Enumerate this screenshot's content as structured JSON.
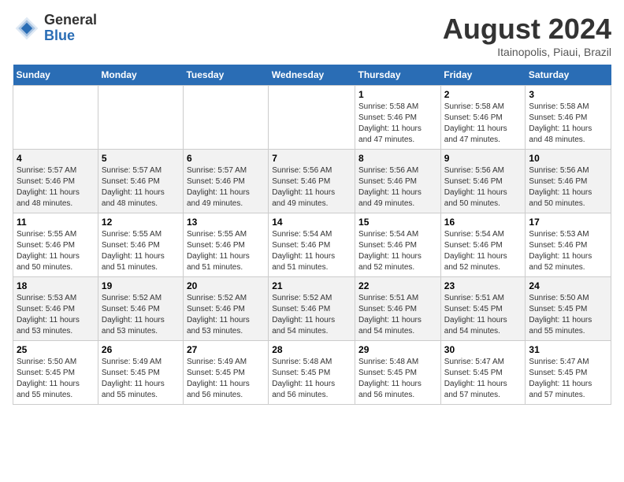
{
  "header": {
    "logo_general": "General",
    "logo_blue": "Blue",
    "month": "August 2024",
    "location": "Itainopolis, Piaui, Brazil"
  },
  "days_of_week": [
    "Sunday",
    "Monday",
    "Tuesday",
    "Wednesday",
    "Thursday",
    "Friday",
    "Saturday"
  ],
  "weeks": [
    [
      {
        "day": "",
        "info": ""
      },
      {
        "day": "",
        "info": ""
      },
      {
        "day": "",
        "info": ""
      },
      {
        "day": "",
        "info": ""
      },
      {
        "day": "1",
        "info": "Sunrise: 5:58 AM\nSunset: 5:46 PM\nDaylight: 11 hours\nand 47 minutes."
      },
      {
        "day": "2",
        "info": "Sunrise: 5:58 AM\nSunset: 5:46 PM\nDaylight: 11 hours\nand 47 minutes."
      },
      {
        "day": "3",
        "info": "Sunrise: 5:58 AM\nSunset: 5:46 PM\nDaylight: 11 hours\nand 48 minutes."
      }
    ],
    [
      {
        "day": "4",
        "info": "Sunrise: 5:57 AM\nSunset: 5:46 PM\nDaylight: 11 hours\nand 48 minutes."
      },
      {
        "day": "5",
        "info": "Sunrise: 5:57 AM\nSunset: 5:46 PM\nDaylight: 11 hours\nand 48 minutes."
      },
      {
        "day": "6",
        "info": "Sunrise: 5:57 AM\nSunset: 5:46 PM\nDaylight: 11 hours\nand 49 minutes."
      },
      {
        "day": "7",
        "info": "Sunrise: 5:56 AM\nSunset: 5:46 PM\nDaylight: 11 hours\nand 49 minutes."
      },
      {
        "day": "8",
        "info": "Sunrise: 5:56 AM\nSunset: 5:46 PM\nDaylight: 11 hours\nand 49 minutes."
      },
      {
        "day": "9",
        "info": "Sunrise: 5:56 AM\nSunset: 5:46 PM\nDaylight: 11 hours\nand 50 minutes."
      },
      {
        "day": "10",
        "info": "Sunrise: 5:56 AM\nSunset: 5:46 PM\nDaylight: 11 hours\nand 50 minutes."
      }
    ],
    [
      {
        "day": "11",
        "info": "Sunrise: 5:55 AM\nSunset: 5:46 PM\nDaylight: 11 hours\nand 50 minutes."
      },
      {
        "day": "12",
        "info": "Sunrise: 5:55 AM\nSunset: 5:46 PM\nDaylight: 11 hours\nand 51 minutes."
      },
      {
        "day": "13",
        "info": "Sunrise: 5:55 AM\nSunset: 5:46 PM\nDaylight: 11 hours\nand 51 minutes."
      },
      {
        "day": "14",
        "info": "Sunrise: 5:54 AM\nSunset: 5:46 PM\nDaylight: 11 hours\nand 51 minutes."
      },
      {
        "day": "15",
        "info": "Sunrise: 5:54 AM\nSunset: 5:46 PM\nDaylight: 11 hours\nand 52 minutes."
      },
      {
        "day": "16",
        "info": "Sunrise: 5:54 AM\nSunset: 5:46 PM\nDaylight: 11 hours\nand 52 minutes."
      },
      {
        "day": "17",
        "info": "Sunrise: 5:53 AM\nSunset: 5:46 PM\nDaylight: 11 hours\nand 52 minutes."
      }
    ],
    [
      {
        "day": "18",
        "info": "Sunrise: 5:53 AM\nSunset: 5:46 PM\nDaylight: 11 hours\nand 53 minutes."
      },
      {
        "day": "19",
        "info": "Sunrise: 5:52 AM\nSunset: 5:46 PM\nDaylight: 11 hours\nand 53 minutes."
      },
      {
        "day": "20",
        "info": "Sunrise: 5:52 AM\nSunset: 5:46 PM\nDaylight: 11 hours\nand 53 minutes."
      },
      {
        "day": "21",
        "info": "Sunrise: 5:52 AM\nSunset: 5:46 PM\nDaylight: 11 hours\nand 54 minutes."
      },
      {
        "day": "22",
        "info": "Sunrise: 5:51 AM\nSunset: 5:46 PM\nDaylight: 11 hours\nand 54 minutes."
      },
      {
        "day": "23",
        "info": "Sunrise: 5:51 AM\nSunset: 5:45 PM\nDaylight: 11 hours\nand 54 minutes."
      },
      {
        "day": "24",
        "info": "Sunrise: 5:50 AM\nSunset: 5:45 PM\nDaylight: 11 hours\nand 55 minutes."
      }
    ],
    [
      {
        "day": "25",
        "info": "Sunrise: 5:50 AM\nSunset: 5:45 PM\nDaylight: 11 hours\nand 55 minutes."
      },
      {
        "day": "26",
        "info": "Sunrise: 5:49 AM\nSunset: 5:45 PM\nDaylight: 11 hours\nand 55 minutes."
      },
      {
        "day": "27",
        "info": "Sunrise: 5:49 AM\nSunset: 5:45 PM\nDaylight: 11 hours\nand 56 minutes."
      },
      {
        "day": "28",
        "info": "Sunrise: 5:48 AM\nSunset: 5:45 PM\nDaylight: 11 hours\nand 56 minutes."
      },
      {
        "day": "29",
        "info": "Sunrise: 5:48 AM\nSunset: 5:45 PM\nDaylight: 11 hours\nand 56 minutes."
      },
      {
        "day": "30",
        "info": "Sunrise: 5:47 AM\nSunset: 5:45 PM\nDaylight: 11 hours\nand 57 minutes."
      },
      {
        "day": "31",
        "info": "Sunrise: 5:47 AM\nSunset: 5:45 PM\nDaylight: 11 hours\nand 57 minutes."
      }
    ]
  ]
}
